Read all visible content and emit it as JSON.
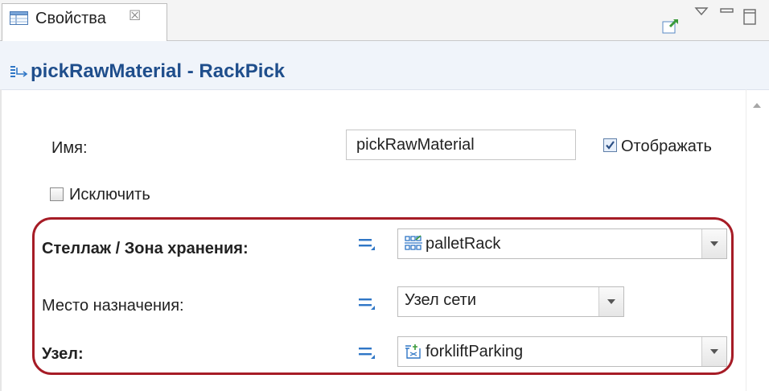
{
  "tab": {
    "label": "Свойства",
    "close": "☒"
  },
  "header": {
    "title": "pickRawMaterial - RackPick"
  },
  "form": {
    "name_label": "Имя:",
    "name_value": "pickRawMaterial",
    "show_label": "Отображать",
    "show_checked": true,
    "exclude_label": "Исключить",
    "exclude_checked": false,
    "rack_label": "Стеллаж / Зона хранения:",
    "rack_value": "palletRack",
    "dest_label": "Место назначения:",
    "dest_value": "Узел сети",
    "node_label": "Узел:",
    "node_value": "forkliftParking"
  },
  "colors": {
    "title": "#1f4e8c",
    "highlight": "#a61c26",
    "accent": "#2f76c6"
  }
}
